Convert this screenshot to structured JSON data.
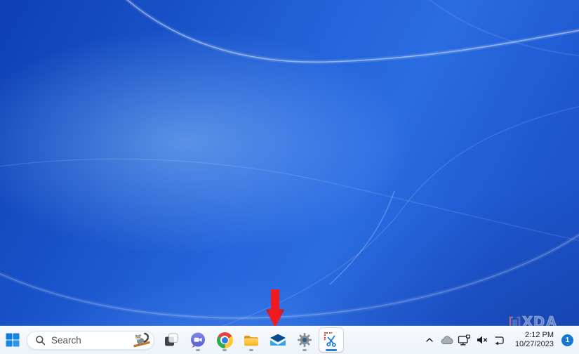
{
  "wallpaper": {
    "description": "blue swirl desktop background with light sweeping streaks",
    "base_color": "#2464dc",
    "dark_corner_color": "#0f3fb4",
    "glow_color": "#96c8fc"
  },
  "taskbar": {
    "background_color": "#f2f6fb",
    "start": {
      "icon": "windows-logo-icon",
      "color": "#0f7ad8"
    },
    "search": {
      "placeholder": "Search",
      "icon": "search-icon",
      "thumbnail": "lemur-on-branch-image"
    },
    "apps": [
      {
        "id": "task-view",
        "icon": "task-view-icon",
        "running": false,
        "active": false
      },
      {
        "id": "chat",
        "icon": "chat-video-icon",
        "running": true,
        "active": false
      },
      {
        "id": "chrome",
        "icon": "chrome-icon",
        "running": true,
        "active": false
      },
      {
        "id": "file-explorer",
        "icon": "folder-icon",
        "running": true,
        "active": false
      },
      {
        "id": "mail",
        "icon": "mail-envelope-icon",
        "running": false,
        "active": false
      },
      {
        "id": "settings",
        "icon": "gear-icon",
        "running": true,
        "active": false
      },
      {
        "id": "snipping-tool",
        "icon": "snipping-tool-icon",
        "running": true,
        "active": true
      }
    ],
    "tray": {
      "icons": [
        {
          "id": "chevron-up-icon"
        },
        {
          "id": "onedrive-cloud-icon"
        },
        {
          "id": "network-ethernet-icon"
        },
        {
          "id": "volume-muted-icon"
        },
        {
          "id": "restart-arrow-icon"
        }
      ],
      "clock": {
        "time": "2:12 PM",
        "date": "10/27/2023"
      },
      "notification_badge": {
        "count": "1",
        "color": "#1577d1"
      }
    }
  },
  "annotation": {
    "type": "red-down-arrow",
    "color": "#f01b22",
    "points_to": "mail taskbar icon"
  },
  "watermark": {
    "text": "XDA"
  }
}
